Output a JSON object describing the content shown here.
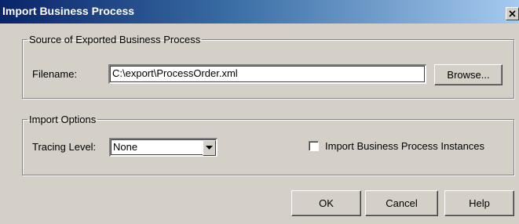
{
  "window": {
    "title": "Import Business Process",
    "close_glyph": "close-icon"
  },
  "source_group": {
    "legend": "Source of Exported Business Process",
    "filename_label": "Filename:",
    "filename_value": "C:\\export\\ProcessOrder.xml",
    "browse_label": "Browse..."
  },
  "options_group": {
    "legend": "Import Options",
    "tracing_label": "Tracing Level:",
    "tracing_value": "None",
    "import_instances_label": "Import Business Process Instances",
    "import_instances_checked": false
  },
  "buttons": {
    "ok": "OK",
    "cancel": "Cancel",
    "help": "Help"
  },
  "colors": {
    "titlebar_start": "#0a246a",
    "titlebar_end": "#a6caf0",
    "face": "#d4d0c8"
  }
}
